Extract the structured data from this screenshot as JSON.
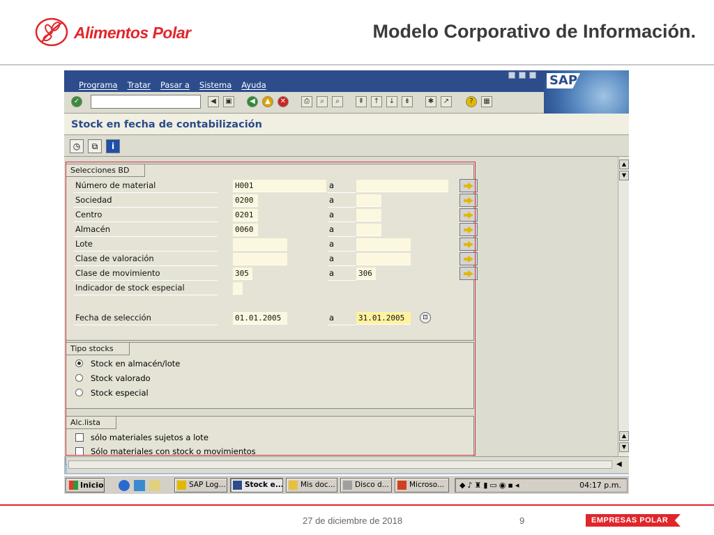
{
  "slide": {
    "logo_text": "Alimentos Polar",
    "title": "Modelo Corporativo de Información.",
    "footer_date": "27 de diciembre de 2018",
    "page_number": "9",
    "footer_brand": "EMPRESAS POLAR"
  },
  "sap": {
    "logo": "SAP",
    "menu": [
      "Programa",
      "Tratar",
      "Pasar a",
      "Sistema",
      "Ayuda"
    ],
    "page_title": "Stock en fecha de contabilización",
    "selections": {
      "title": "Selecciones BD",
      "rows": [
        {
          "label": "Número de material",
          "from": "H001",
          "to": ""
        },
        {
          "label": "Sociedad",
          "from": "0200",
          "to": ""
        },
        {
          "label": "Centro",
          "from": "0201",
          "to": ""
        },
        {
          "label": "Almacén",
          "from": "0060",
          "to": ""
        },
        {
          "label": "Lote",
          "from": "",
          "to": ""
        },
        {
          "label": "Clase de valoración",
          "from": "",
          "to": ""
        },
        {
          "label": "Clase de movimiento",
          "from": "305",
          "to": "306"
        },
        {
          "label": "Indicador de stock especial",
          "from": "",
          "to": null
        }
      ],
      "to_label": "a",
      "date": {
        "label": "Fecha de selección",
        "from": "01.01.2005",
        "to": "31.01.2005"
      }
    },
    "stock_type": {
      "title": "Tipo stocks",
      "options": [
        {
          "label": "Stock en almacén/lote",
          "selected": true
        },
        {
          "label": "Stock valorado",
          "selected": false
        },
        {
          "label": "Stock especial",
          "selected": false
        }
      ]
    },
    "scope": {
      "title": "Alc.lista",
      "options": [
        {
          "label": "sólo materiales sujetos a lote",
          "checked": false
        },
        {
          "label": "Sólo materiales con stock o movimientos",
          "checked": false
        }
      ]
    },
    "taskbar": {
      "start": "Inicio",
      "tasks": [
        "SAP Log...",
        "Stock e...",
        "Mis doc...",
        "Disco d...",
        "Microso..."
      ],
      "clock": "04:17 p.m."
    },
    "colors": {
      "menubar": "#2c4c8c",
      "highlight_box": "#d32f3f",
      "brand_red": "#e1262b"
    }
  }
}
